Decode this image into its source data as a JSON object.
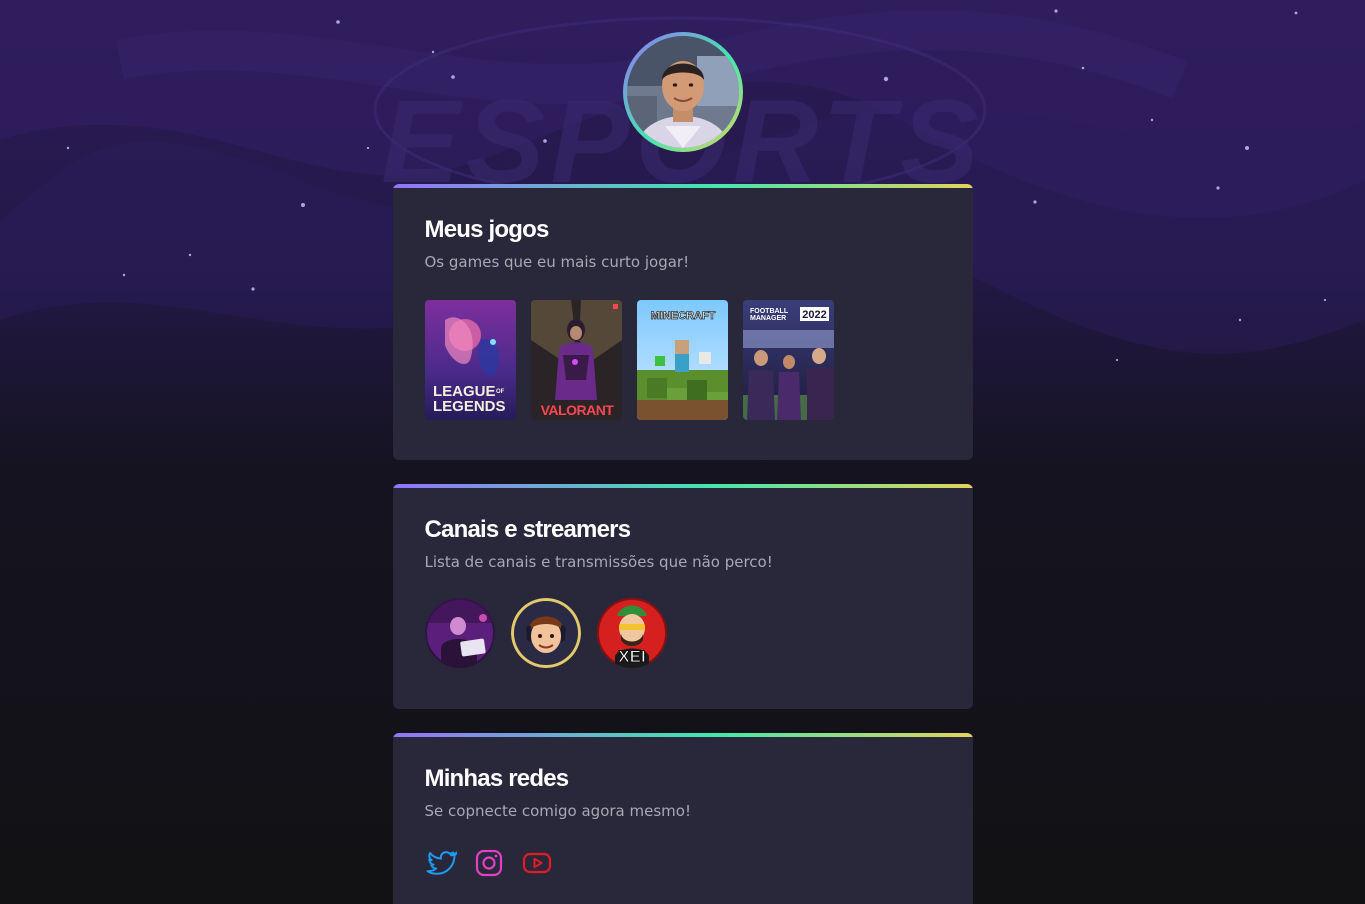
{
  "profile": {
    "avatar_icon": "user-avatar-photo"
  },
  "sections": {
    "games": {
      "title": "Meus jogos",
      "subtitle": "Os games que eu mais curto jogar!",
      "items": [
        {
          "name": "League of Legends",
          "cover_text_1": "LEAGUE",
          "cover_text_2": "LEGENDS",
          "cover_text_of": "OF",
          "color": "#6a2c8c"
        },
        {
          "name": "Valorant",
          "cover_text_1": "VALORANT",
          "color": "#ff4655"
        },
        {
          "name": "Minecraft",
          "cover_text_1": "MINECRAFT",
          "color": "#5c9e3a"
        },
        {
          "name": "Football Manager 2022",
          "cover_text_1": "FOOTBALL",
          "cover_text_2": "MANAGER",
          "cover_text_3": "2022",
          "color": "#2c2a5a"
        }
      ]
    },
    "streamers": {
      "title": "Canais e streamers",
      "subtitle": "Lista de canais e transmissões que não perco!",
      "items": [
        {
          "name": "streamer-1",
          "icon": "streamer-avatar-purple",
          "color": "#6b2a8f"
        },
        {
          "name": "streamer-2",
          "icon": "streamer-avatar-cartoon",
          "color": "#2b2a44"
        },
        {
          "name": "streamer-3",
          "icon": "streamer-avatar-xei",
          "badge": "XEI",
          "color": "#d61f1f"
        }
      ]
    },
    "social": {
      "title": "Minhas redes",
      "subtitle": "Se copnecte comigo agora mesmo!",
      "items": [
        {
          "name": "twitter",
          "icon": "twitter-icon",
          "color": "#1d9bf0"
        },
        {
          "name": "instagram",
          "icon": "instagram-icon",
          "color": "#e140c4"
        },
        {
          "name": "youtube",
          "icon": "youtube-icon",
          "color": "#e21c24"
        }
      ]
    }
  },
  "background": {
    "watermark_text": "ESPORTS",
    "top_color": "#2a1a52",
    "bottom_color": "#121214"
  }
}
